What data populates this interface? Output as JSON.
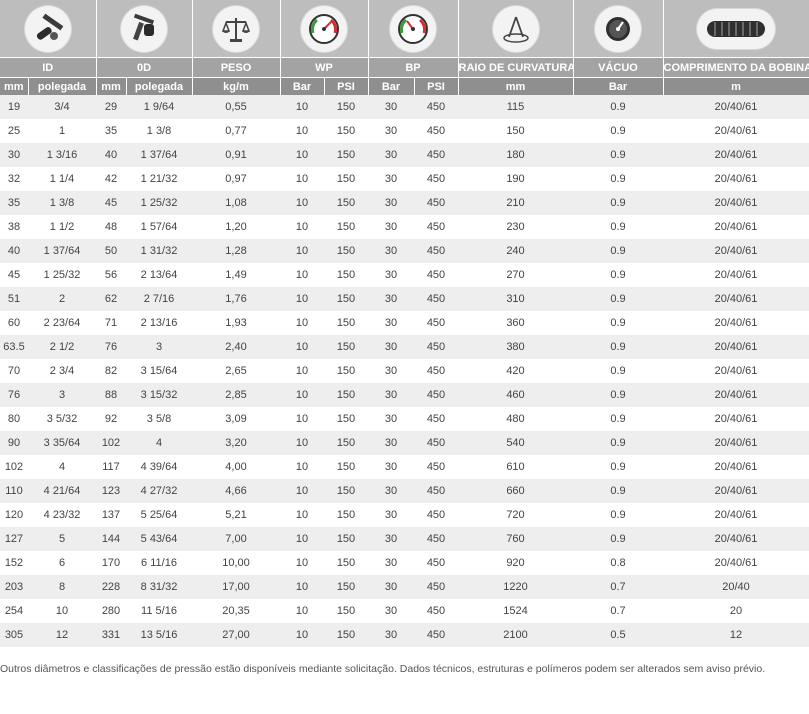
{
  "icons": [
    {
      "name": "caliper-id-icon"
    },
    {
      "name": "caliper-od-icon"
    },
    {
      "name": "scale-icon"
    },
    {
      "name": "pressure-gauge-wp-icon"
    },
    {
      "name": "pressure-gauge-bp-icon"
    },
    {
      "name": "bend-radius-icon"
    },
    {
      "name": "vacuum-gauge-icon"
    },
    {
      "name": "hose-coil-icon"
    }
  ],
  "headers": {
    "id": "ID",
    "od": "0D",
    "peso": "PESO",
    "wp": "WP",
    "bp": "BP",
    "raio": "RAIO DE CURVATURA",
    "vacuo": "VÁCUO",
    "comprimento": "COMPRIMENTO DA BOBINA"
  },
  "units": [
    "mm",
    "polegada",
    "mm",
    "polegada",
    "kg/m",
    "Bar",
    "PSI",
    "Bar",
    "PSI",
    "mm",
    "Bar",
    "m"
  ],
  "rows": [
    [
      "19",
      "3/4",
      "29",
      "1 9/64",
      "0,55",
      "10",
      "150",
      "30",
      "450",
      "115",
      "0.9",
      "20/40/61"
    ],
    [
      "25",
      "1",
      "35",
      "1 3/8",
      "0,77",
      "10",
      "150",
      "30",
      "450",
      "150",
      "0.9",
      "20/40/61"
    ],
    [
      "30",
      "1 3/16",
      "40",
      "1 37/64",
      "0,91",
      "10",
      "150",
      "30",
      "450",
      "180",
      "0.9",
      "20/40/61"
    ],
    [
      "32",
      "1 1/4",
      "42",
      "1 21/32",
      "0,97",
      "10",
      "150",
      "30",
      "450",
      "190",
      "0.9",
      "20/40/61"
    ],
    [
      "35",
      "1 3/8",
      "45",
      "1 25/32",
      "1,08",
      "10",
      "150",
      "30",
      "450",
      "210",
      "0.9",
      "20/40/61"
    ],
    [
      "38",
      "1 1/2",
      "48",
      "1 57/64",
      "1,20",
      "10",
      "150",
      "30",
      "450",
      "230",
      "0.9",
      "20/40/61"
    ],
    [
      "40",
      "1 37/64",
      "50",
      "1 31/32",
      "1,28",
      "10",
      "150",
      "30",
      "450",
      "240",
      "0.9",
      "20/40/61"
    ],
    [
      "45",
      "1 25/32",
      "56",
      "2 13/64",
      "1,49",
      "10",
      "150",
      "30",
      "450",
      "270",
      "0.9",
      "20/40/61"
    ],
    [
      "51",
      "2",
      "62",
      "2 7/16",
      "1,76",
      "10",
      "150",
      "30",
      "450",
      "310",
      "0.9",
      "20/40/61"
    ],
    [
      "60",
      "2 23/64",
      "71",
      "2 13/16",
      "1,93",
      "10",
      "150",
      "30",
      "450",
      "360",
      "0.9",
      "20/40/61"
    ],
    [
      "63.5",
      "2 1/2",
      "76",
      "3",
      "2,40",
      "10",
      "150",
      "30",
      "450",
      "380",
      "0.9",
      "20/40/61"
    ],
    [
      "70",
      "2 3/4",
      "82",
      "3 15/64",
      "2,65",
      "10",
      "150",
      "30",
      "450",
      "420",
      "0.9",
      "20/40/61"
    ],
    [
      "76",
      "3",
      "88",
      "3 15/32",
      "2,85",
      "10",
      "150",
      "30",
      "450",
      "460",
      "0.9",
      "20/40/61"
    ],
    [
      "80",
      "3 5/32",
      "92",
      "3 5/8",
      "3,09",
      "10",
      "150",
      "30",
      "450",
      "480",
      "0.9",
      "20/40/61"
    ],
    [
      "90",
      "3 35/64",
      "102",
      "4",
      "3,20",
      "10",
      "150",
      "30",
      "450",
      "540",
      "0.9",
      "20/40/61"
    ],
    [
      "102",
      "4",
      "117",
      "4 39/64",
      "4,00",
      "10",
      "150",
      "30",
      "450",
      "610",
      "0.9",
      "20/40/61"
    ],
    [
      "110",
      "4 21/64",
      "123",
      "4 27/32",
      "4,66",
      "10",
      "150",
      "30",
      "450",
      "660",
      "0.9",
      "20/40/61"
    ],
    [
      "120",
      "4 23/32",
      "137",
      "5 25/64",
      "5,21",
      "10",
      "150",
      "30",
      "450",
      "720",
      "0.9",
      "20/40/61"
    ],
    [
      "127",
      "5",
      "144",
      "5 43/64",
      "7,00",
      "10",
      "150",
      "30",
      "450",
      "760",
      "0.9",
      "20/40/61"
    ],
    [
      "152",
      "6",
      "170",
      "6 11/16",
      "10,00",
      "10",
      "150",
      "30",
      "450",
      "920",
      "0.8",
      "20/40/61"
    ],
    [
      "203",
      "8",
      "228",
      "8 31/32",
      "17,00",
      "10",
      "150",
      "30",
      "450",
      "1220",
      "0.7",
      "20/40"
    ],
    [
      "254",
      "10",
      "280",
      "11 5/16",
      "20,35",
      "10",
      "150",
      "30",
      "450",
      "1524",
      "0.7",
      "20"
    ],
    [
      "305",
      "12",
      "331",
      "13 5/16",
      "27,00",
      "10",
      "150",
      "30",
      "450",
      "2100",
      "0.5",
      "12"
    ]
  ],
  "footnote": "Outros diâmetros e classificações de pressão estão disponíveis mediante solicitação. Dados técnicos, estruturas e polímeros podem ser alterados sem aviso prévio.",
  "colors": {
    "icon_band": "#bdbdbd",
    "header_band": "#a3a3a3",
    "unit_band": "#8f8f8f",
    "row_stripe": "#eeeeee",
    "gauge_needle_red": "#d32f2f",
    "gauge_green": "#3a9b3a"
  }
}
